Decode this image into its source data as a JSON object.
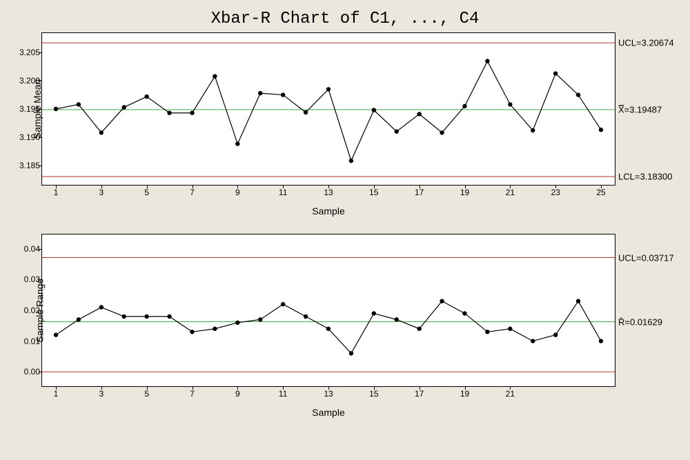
{
  "title": "Xbar-R Chart of C1, ..., C4",
  "chart_data": [
    {
      "type": "line",
      "name": "Xbar",
      "ylabel": "Sample Mean",
      "xlabel": "Sample",
      "ylim": [
        3.183,
        3.207
      ],
      "yticks": [
        3.185,
        3.19,
        3.195,
        3.2,
        3.205
      ],
      "xticks": [
        1,
        3,
        5,
        7,
        9,
        11,
        13,
        15,
        17,
        19,
        21,
        23,
        25
      ],
      "center": 3.19487,
      "ucl": 3.20674,
      "lcl": 3.183,
      "center_label": "X̿=3.19487",
      "ucl_label": "UCL=3.20674",
      "lcl_label": "LCL=3.18300",
      "x": [
        1,
        2,
        3,
        4,
        5,
        6,
        7,
        8,
        9,
        10,
        11,
        12,
        13,
        14,
        15,
        16,
        17,
        18,
        19,
        20,
        21,
        22,
        23,
        24,
        25
      ],
      "values": [
        3.195,
        3.1958,
        3.1908,
        3.1953,
        3.1972,
        3.1943,
        3.1943,
        3.2008,
        3.1888,
        3.1978,
        3.1975,
        3.1944,
        3.1985,
        3.1858,
        3.1948,
        3.191,
        3.1941,
        3.1908,
        3.1955,
        3.2035,
        3.1958,
        3.1912,
        3.2013,
        3.1975,
        3.1913
      ]
    },
    {
      "type": "line",
      "name": "R",
      "ylabel": "Sample Range",
      "xlabel": "Sample",
      "ylim": [
        -0.002,
        0.042
      ],
      "yticks": [
        0.0,
        0.01,
        0.02,
        0.03,
        0.04
      ],
      "xticks": [
        1,
        3,
        5,
        7,
        9,
        11,
        13,
        15,
        17,
        19,
        21
      ],
      "center": 0.01629,
      "ucl": 0.03717,
      "lcl": 0.0,
      "center_label": "R̄=0.01629",
      "ucl_label": "UCL=0.03717",
      "lcl_label": "",
      "x": [
        1,
        2,
        3,
        4,
        5,
        6,
        7,
        8,
        9,
        10,
        11,
        12,
        13,
        14,
        15,
        16,
        17,
        18,
        19,
        20,
        21,
        22,
        23,
        24,
        25
      ],
      "values": [
        0.012,
        0.017,
        0.021,
        0.018,
        0.018,
        0.018,
        0.013,
        0.014,
        0.016,
        0.017,
        0.022,
        0.018,
        0.014,
        0.006,
        0.019,
        0.017,
        0.014,
        0.023,
        0.019,
        0.013,
        0.014,
        0.01,
        0.012,
        0.023,
        0.01
      ]
    }
  ]
}
